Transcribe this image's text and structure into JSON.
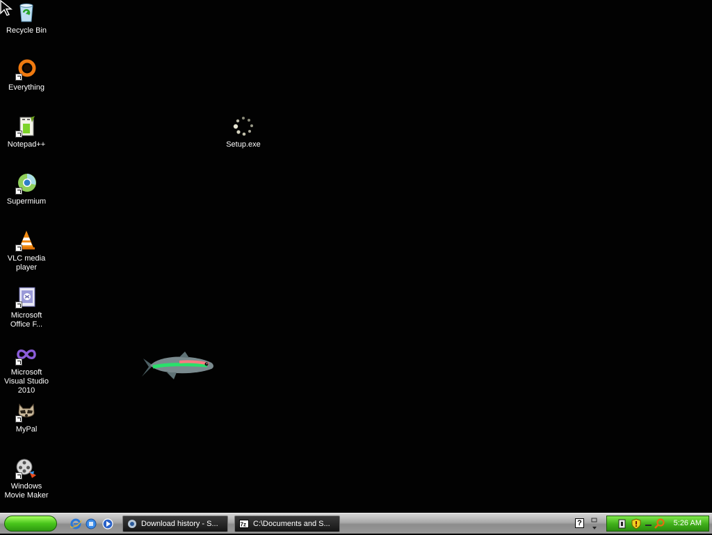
{
  "desktop": {
    "icons": [
      {
        "label": "Recycle Bin"
      },
      {
        "label": "Everything"
      },
      {
        "label": "Notepad++"
      },
      {
        "label": "Supermium"
      },
      {
        "label": "VLC media player"
      },
      {
        "label": "Microsoft Office F..."
      },
      {
        "label": "Microsoft Visual Studio 2010"
      },
      {
        "label": "MyPal"
      },
      {
        "label": "Windows Movie Maker"
      },
      {
        "label": "Setup.exe"
      }
    ]
  },
  "taskbar": {
    "tasks": [
      {
        "label": "Download history - S..."
      },
      {
        "label": "C:\\Documents and S..."
      }
    ],
    "help_label": "?",
    "clock": "5:26 AM"
  },
  "colors": {
    "desktop_background": "#020202",
    "start_button": "#48c51b",
    "tray": "#3fae1a"
  }
}
